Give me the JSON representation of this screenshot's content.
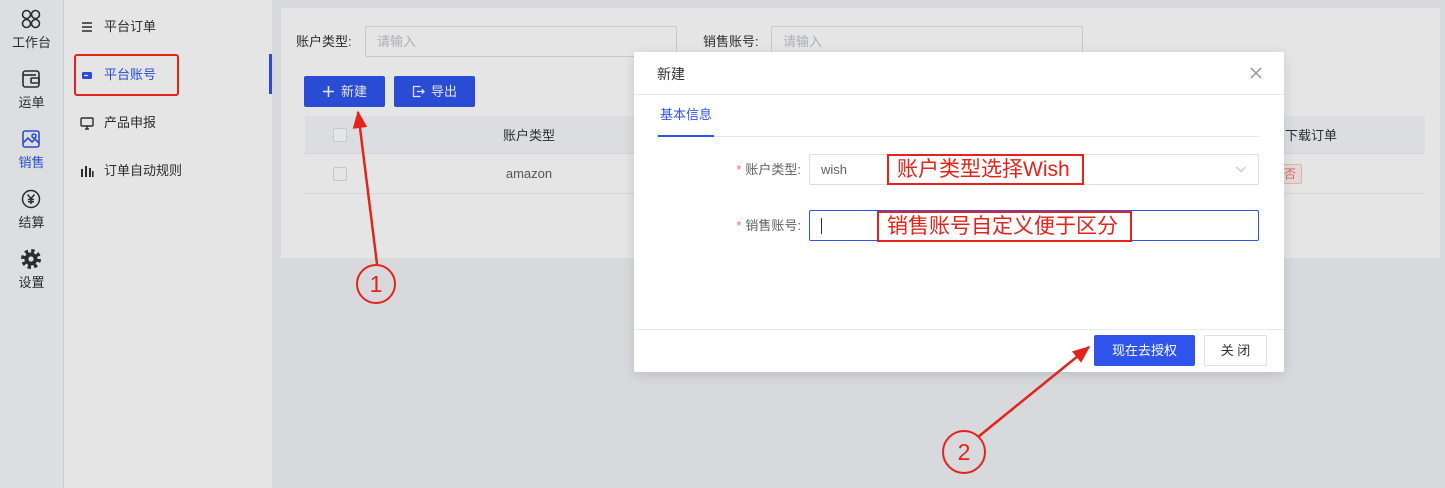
{
  "colors": {
    "accent": "#2f54eb",
    "annotation": "#e4231b",
    "tag_danger": "#f56c6c"
  },
  "rail": {
    "items": [
      {
        "label": "工作台",
        "icon": "workbench-icon"
      },
      {
        "label": "运单",
        "icon": "waybill-icon"
      },
      {
        "label": "销售",
        "icon": "sales-icon",
        "active": true
      },
      {
        "label": "结算",
        "icon": "settlement-icon"
      },
      {
        "label": "设置",
        "icon": "gear-icon"
      }
    ]
  },
  "sidebar": {
    "items": [
      {
        "label": "平台订单",
        "icon": "menu-list-icon"
      },
      {
        "label": "平台账号",
        "icon": "card-icon",
        "active": true
      },
      {
        "label": "产品申报",
        "icon": "monitor-icon"
      },
      {
        "label": "订单自动规则",
        "icon": "bar-chart-icon"
      }
    ]
  },
  "filters": {
    "account_type": {
      "label": "账户类型:",
      "placeholder": "请输入"
    },
    "sales_account": {
      "label": "销售账号:",
      "placeholder": "请输入"
    }
  },
  "toolbar": {
    "new_label": "新建",
    "export_label": "导出"
  },
  "table": {
    "headers": {
      "account_type": "账户类型",
      "download_orders": "下载订单"
    },
    "rows": [
      {
        "account_type": "amazon",
        "download_orders": "否"
      }
    ]
  },
  "modal": {
    "title": "新建",
    "tabs": [
      {
        "label": "基本信息",
        "active": true
      }
    ],
    "required_mark": "*",
    "fields": {
      "account_type": {
        "label": "账户类型:",
        "value": "wish",
        "required": true
      },
      "sales_account": {
        "label": "销售账号:",
        "required": true
      }
    },
    "buttons": {
      "authorize": "现在去授权",
      "close": "关 闭"
    }
  },
  "annotations": {
    "notes": {
      "account_type": "账户类型选择Wish",
      "sales_account": "销售账号自定义便于区分"
    },
    "steps": [
      "1",
      "2"
    ]
  }
}
